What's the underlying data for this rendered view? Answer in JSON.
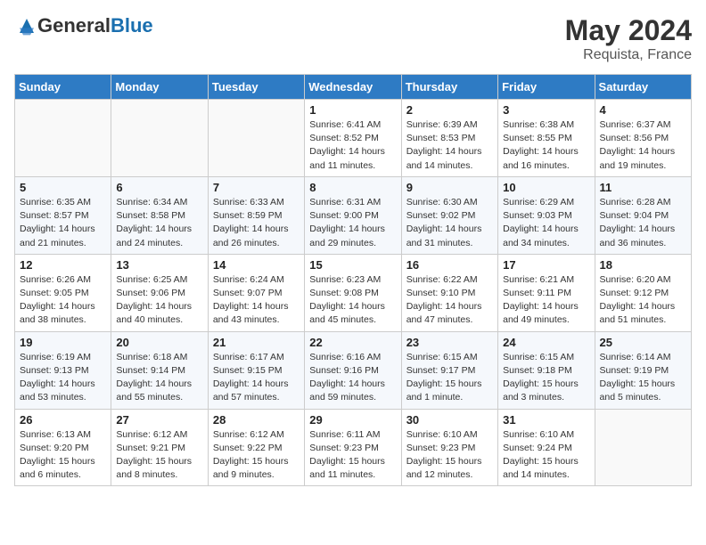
{
  "header": {
    "logo_general": "General",
    "logo_blue": "Blue",
    "month": "May 2024",
    "location": "Requista, France"
  },
  "days_of_week": [
    "Sunday",
    "Monday",
    "Tuesday",
    "Wednesday",
    "Thursday",
    "Friday",
    "Saturday"
  ],
  "weeks": [
    [
      {
        "day": "",
        "info": ""
      },
      {
        "day": "",
        "info": ""
      },
      {
        "day": "",
        "info": ""
      },
      {
        "day": "1",
        "info": "Sunrise: 6:41 AM\nSunset: 8:52 PM\nDaylight: 14 hours\nand 11 minutes."
      },
      {
        "day": "2",
        "info": "Sunrise: 6:39 AM\nSunset: 8:53 PM\nDaylight: 14 hours\nand 14 minutes."
      },
      {
        "day": "3",
        "info": "Sunrise: 6:38 AM\nSunset: 8:55 PM\nDaylight: 14 hours\nand 16 minutes."
      },
      {
        "day": "4",
        "info": "Sunrise: 6:37 AM\nSunset: 8:56 PM\nDaylight: 14 hours\nand 19 minutes."
      }
    ],
    [
      {
        "day": "5",
        "info": "Sunrise: 6:35 AM\nSunset: 8:57 PM\nDaylight: 14 hours\nand 21 minutes."
      },
      {
        "day": "6",
        "info": "Sunrise: 6:34 AM\nSunset: 8:58 PM\nDaylight: 14 hours\nand 24 minutes."
      },
      {
        "day": "7",
        "info": "Sunrise: 6:33 AM\nSunset: 8:59 PM\nDaylight: 14 hours\nand 26 minutes."
      },
      {
        "day": "8",
        "info": "Sunrise: 6:31 AM\nSunset: 9:00 PM\nDaylight: 14 hours\nand 29 minutes."
      },
      {
        "day": "9",
        "info": "Sunrise: 6:30 AM\nSunset: 9:02 PM\nDaylight: 14 hours\nand 31 minutes."
      },
      {
        "day": "10",
        "info": "Sunrise: 6:29 AM\nSunset: 9:03 PM\nDaylight: 14 hours\nand 34 minutes."
      },
      {
        "day": "11",
        "info": "Sunrise: 6:28 AM\nSunset: 9:04 PM\nDaylight: 14 hours\nand 36 minutes."
      }
    ],
    [
      {
        "day": "12",
        "info": "Sunrise: 6:26 AM\nSunset: 9:05 PM\nDaylight: 14 hours\nand 38 minutes."
      },
      {
        "day": "13",
        "info": "Sunrise: 6:25 AM\nSunset: 9:06 PM\nDaylight: 14 hours\nand 40 minutes."
      },
      {
        "day": "14",
        "info": "Sunrise: 6:24 AM\nSunset: 9:07 PM\nDaylight: 14 hours\nand 43 minutes."
      },
      {
        "day": "15",
        "info": "Sunrise: 6:23 AM\nSunset: 9:08 PM\nDaylight: 14 hours\nand 45 minutes."
      },
      {
        "day": "16",
        "info": "Sunrise: 6:22 AM\nSunset: 9:10 PM\nDaylight: 14 hours\nand 47 minutes."
      },
      {
        "day": "17",
        "info": "Sunrise: 6:21 AM\nSunset: 9:11 PM\nDaylight: 14 hours\nand 49 minutes."
      },
      {
        "day": "18",
        "info": "Sunrise: 6:20 AM\nSunset: 9:12 PM\nDaylight: 14 hours\nand 51 minutes."
      }
    ],
    [
      {
        "day": "19",
        "info": "Sunrise: 6:19 AM\nSunset: 9:13 PM\nDaylight: 14 hours\nand 53 minutes."
      },
      {
        "day": "20",
        "info": "Sunrise: 6:18 AM\nSunset: 9:14 PM\nDaylight: 14 hours\nand 55 minutes."
      },
      {
        "day": "21",
        "info": "Sunrise: 6:17 AM\nSunset: 9:15 PM\nDaylight: 14 hours\nand 57 minutes."
      },
      {
        "day": "22",
        "info": "Sunrise: 6:16 AM\nSunset: 9:16 PM\nDaylight: 14 hours\nand 59 minutes."
      },
      {
        "day": "23",
        "info": "Sunrise: 6:15 AM\nSunset: 9:17 PM\nDaylight: 15 hours\nand 1 minute."
      },
      {
        "day": "24",
        "info": "Sunrise: 6:15 AM\nSunset: 9:18 PM\nDaylight: 15 hours\nand 3 minutes."
      },
      {
        "day": "25",
        "info": "Sunrise: 6:14 AM\nSunset: 9:19 PM\nDaylight: 15 hours\nand 5 minutes."
      }
    ],
    [
      {
        "day": "26",
        "info": "Sunrise: 6:13 AM\nSunset: 9:20 PM\nDaylight: 15 hours\nand 6 minutes."
      },
      {
        "day": "27",
        "info": "Sunrise: 6:12 AM\nSunset: 9:21 PM\nDaylight: 15 hours\nand 8 minutes."
      },
      {
        "day": "28",
        "info": "Sunrise: 6:12 AM\nSunset: 9:22 PM\nDaylight: 15 hours\nand 9 minutes."
      },
      {
        "day": "29",
        "info": "Sunrise: 6:11 AM\nSunset: 9:23 PM\nDaylight: 15 hours\nand 11 minutes."
      },
      {
        "day": "30",
        "info": "Sunrise: 6:10 AM\nSunset: 9:23 PM\nDaylight: 15 hours\nand 12 minutes."
      },
      {
        "day": "31",
        "info": "Sunrise: 6:10 AM\nSunset: 9:24 PM\nDaylight: 15 hours\nand 14 minutes."
      },
      {
        "day": "",
        "info": ""
      }
    ]
  ]
}
